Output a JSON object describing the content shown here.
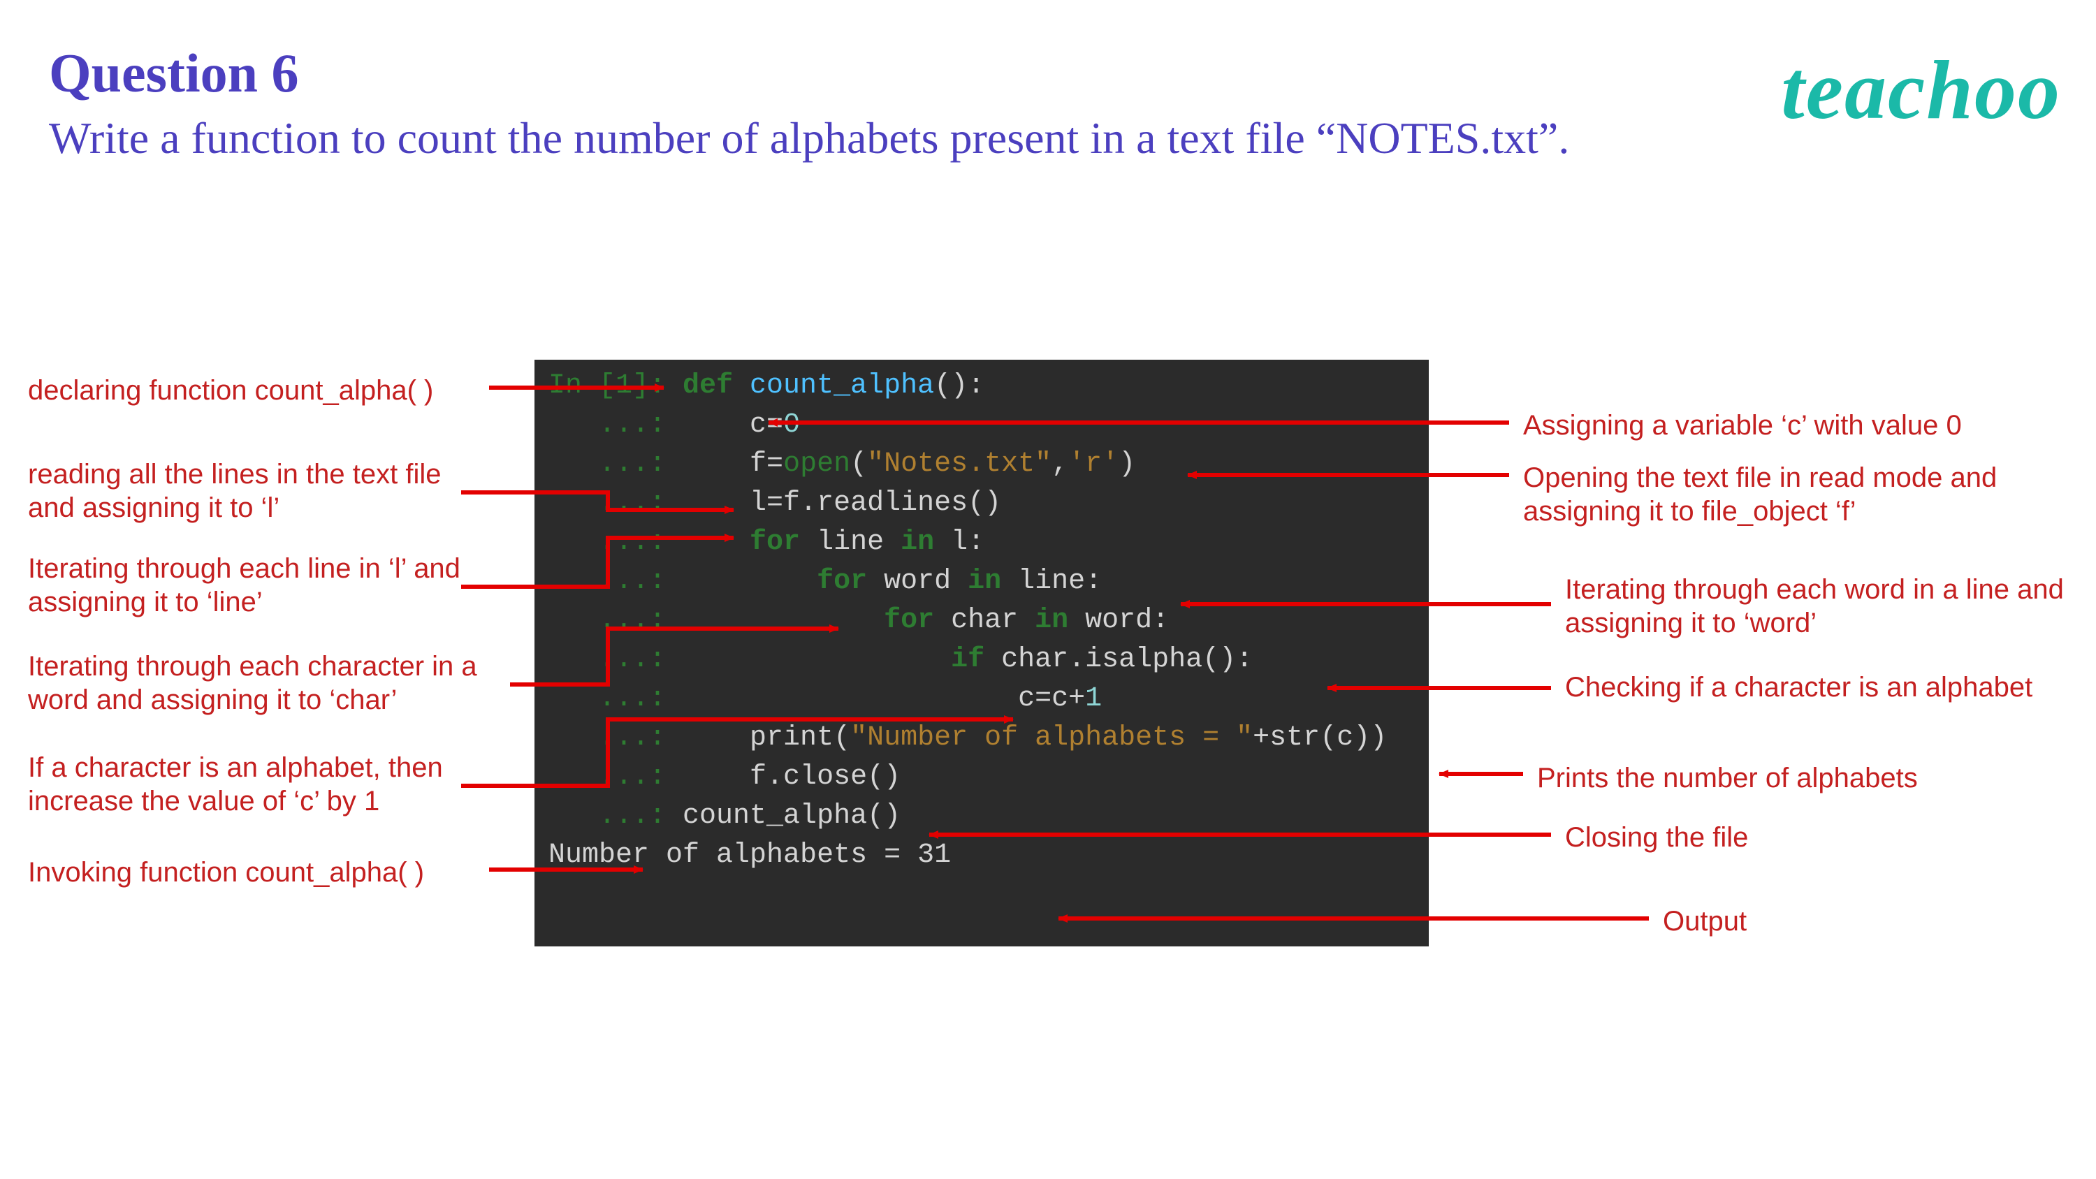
{
  "header": {
    "title": "Question 6",
    "question": "Write a function to count the number of  alphabets present in a text file “NOTES.txt”.",
    "logo": "teachoo"
  },
  "code": {
    "l1_prompt": "In [1]: ",
    "l1_kw": "def ",
    "l1_func": "count_alpha",
    "l1_rest": "():",
    "dots": "   ...: ",
    "l2": "    c=",
    "l2_num": "0",
    "l3a": "    f=",
    "l3b": "open",
    "l3c": "(",
    "l3d": "\"Notes.txt\"",
    "l3e": ",",
    "l3f": "'r'",
    "l3g": ")",
    "l4": "    l=f.readlines()",
    "l5a": "    ",
    "l5b": "for",
    "l5c": " line ",
    "l5d": "in",
    "l5e": " l:",
    "l6a": "        ",
    "l6b": "for",
    "l6c": " word ",
    "l6d": "in",
    "l6e": " line:",
    "l7a": "            ",
    "l7b": "for",
    "l7c": " char ",
    "l7d": "in",
    "l7e": " word:",
    "l8a": "                ",
    "l8b": "if",
    "l8c": " char.isalpha():",
    "l9": "                    c=c+",
    "l9_num": "1",
    "l10a": "    print(",
    "l10b": "\"Number of alphabets = \"",
    "l10c": "+str(c))",
    "l11": "    f.close()",
    "l12": "count_alpha()",
    "output": "Number of alphabets = 31"
  },
  "ann": {
    "left1": "declaring function count_alpha( )",
    "left2": "reading all the lines in the text file and assigning it to ‘l’",
    "left3": "Iterating through each line in ‘l’ and assigning it to ‘line’",
    "left4": "Iterating through each character in a word and assigning it to ‘char’",
    "left5": "If a character is an alphabet, then increase the value of ‘c’ by 1",
    "left6": "Invoking function count_alpha( )",
    "right1": "Assigning a variable ‘c’ with value 0",
    "right2": "Opening the text file in read mode and assigning it to file_object ‘f’",
    "right3": "Iterating through each word in a line and assigning it to ‘word’",
    "right4": "Checking if a character is an alphabet",
    "right5": "Prints the number of alphabets",
    "right6": "Closing the file",
    "right7": "Output"
  }
}
